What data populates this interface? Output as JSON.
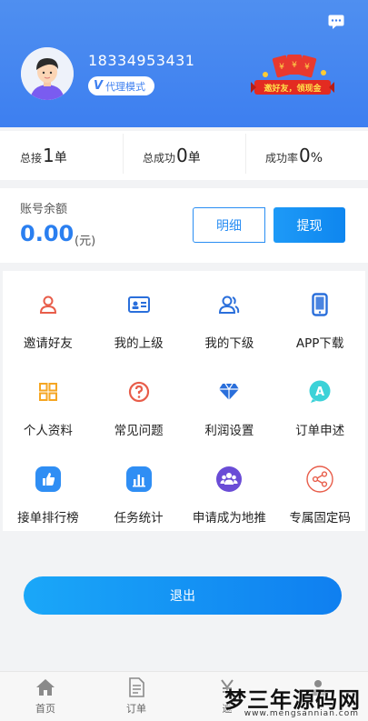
{
  "header": {
    "phone": "18334953431",
    "mode_badge": "代理模式",
    "promo_text": "邀好友，领现金"
  },
  "stats": [
    {
      "label": "总接",
      "value": "1",
      "unit": "单"
    },
    {
      "label": "总成功",
      "value": "0",
      "unit": "单"
    },
    {
      "label": "成功率",
      "value": "0",
      "unit": "%"
    }
  ],
  "balance": {
    "label": "账号余额",
    "amount": "0.00",
    "unit": "(元)",
    "detail_label": "明细",
    "withdraw_label": "提现"
  },
  "menu": [
    {
      "label": "邀请好友",
      "icon": "person-icon",
      "color": "#e85d4a"
    },
    {
      "label": "我的上级",
      "icon": "id-card-icon",
      "color": "#2a6fdb"
    },
    {
      "label": "我的下级",
      "icon": "people-icon",
      "color": "#2a6fdb"
    },
    {
      "label": "APP下载",
      "icon": "phone-icon",
      "color": "#2a6fdb"
    },
    {
      "label": "个人资料",
      "icon": "grid-icon",
      "color": "#f5a623"
    },
    {
      "label": "常见问题",
      "icon": "question-icon",
      "color": "#e85d4a"
    },
    {
      "label": "利润设置",
      "icon": "diamond-icon",
      "color": "#2a6fdb"
    },
    {
      "label": "订单申述",
      "icon": "appeal-icon",
      "color": "#3cd2d8"
    },
    {
      "label": "接单排行榜",
      "icon": "thumbs-up-icon",
      "color": "#2f8ef4"
    },
    {
      "label": "任务统计",
      "icon": "bar-chart-icon",
      "color": "#2f8ef4"
    },
    {
      "label": "申请成为地推",
      "icon": "team-icon",
      "color": "#6a4cd6"
    },
    {
      "label": "专属固定码",
      "icon": "share-icon",
      "color": "#e85d4a"
    }
  ],
  "logout_label": "退出",
  "tabs": [
    {
      "label": "首页",
      "icon": "home-icon"
    },
    {
      "label": "订单",
      "icon": "document-icon"
    },
    {
      "label": "邀",
      "icon": "yen-icon"
    },
    {
      "label": "",
      "icon": "profile-icon"
    }
  ],
  "watermark": {
    "title": "梦三年源码网",
    "url": "www.mengsannian.com"
  }
}
